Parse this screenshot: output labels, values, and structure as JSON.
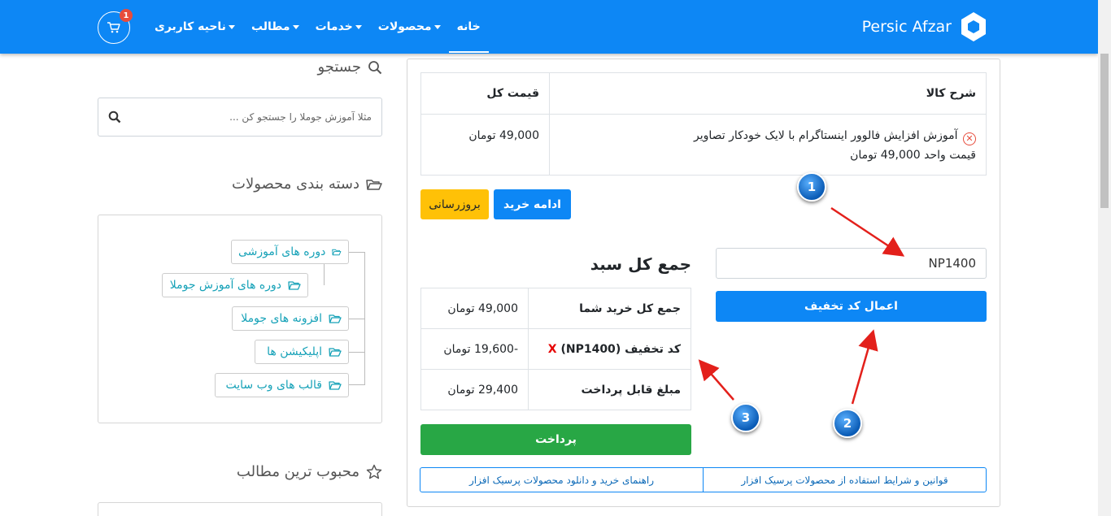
{
  "navbar": {
    "brand": "Persic Afzar",
    "items": [
      {
        "label": "خانه",
        "dropdown": false,
        "active": true
      },
      {
        "label": "محصولات",
        "dropdown": true,
        "active": false
      },
      {
        "label": "خدمات",
        "dropdown": true,
        "active": false
      },
      {
        "label": "مطالب",
        "dropdown": true,
        "active": false
      },
      {
        "label": "ناحیه کاربری",
        "dropdown": true,
        "active": false
      }
    ],
    "cart_count": "1",
    "cart_icon": "cart-icon",
    "bg_color": "#0d87f5"
  },
  "sidebar": {
    "search_heading": "جستجو",
    "search_placeholder": "مثلا آموزش جوملا را جستجو کن ...",
    "categories_heading": "دسته بندی محصولات",
    "categories": [
      {
        "label": "دوره های آموزشی",
        "level": 0
      },
      {
        "label": "دوره های آموزش جوملا",
        "level": 1
      },
      {
        "label": "افزونه های جوملا",
        "level": 0
      },
      {
        "label": "اپلیکیشن ها",
        "level": 0
      },
      {
        "label": "قالب های وب سایت",
        "level": 0
      }
    ],
    "popular_heading": "محبوب ترین مطالب"
  },
  "cart": {
    "headers": {
      "description": "شرح کالا",
      "total": "قیمت کل"
    },
    "items": [
      {
        "name": "آموزش افزایش فالوور اینستاگرام با لایک خودکار تصاویر",
        "unit_price": "قیمت واحد 49,000 تومان",
        "total": "49,000 تومان"
      }
    ],
    "continue_label": "ادامه خرید",
    "update_label": "بروزرسانی"
  },
  "coupon": {
    "value": "NP1400",
    "apply_label": "اعمال کد تخفیف"
  },
  "totals": {
    "title": "جمع کل سبد",
    "rows": [
      {
        "label": "جمع کل خرید شما",
        "value": "49,000 تومان"
      },
      {
        "label": "کد تخفیف (NP1400)",
        "value": "-19,600 تومان",
        "remove": "X"
      },
      {
        "label": "مبلغ قابل پرداخت",
        "value": "29,400 تومان"
      }
    ],
    "pay_label": "پرداخت"
  },
  "footer_links": [
    "قوانین و شرایط استفاده از محصولات پرسیک افزار",
    "راهنمای خرید و دانلود محصولات پرسیک افزار"
  ],
  "markers": [
    "1",
    "2",
    "3"
  ]
}
